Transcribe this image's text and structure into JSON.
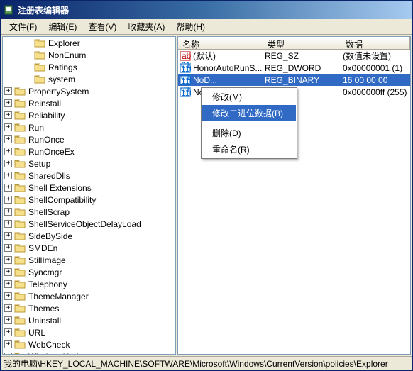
{
  "window": {
    "title": "注册表编辑器"
  },
  "menubar": {
    "file": "文件(F)",
    "edit": "编辑(E)",
    "view": "查看(V)",
    "favorites": "收藏夹(A)",
    "help": "帮助(H)"
  },
  "tree_expanded_children": [
    {
      "label": "Explorer"
    },
    {
      "label": "NonEnum"
    },
    {
      "label": "Ratings"
    },
    {
      "label": "system"
    }
  ],
  "tree_items": [
    {
      "label": "PropertySystem"
    },
    {
      "label": "Reinstall"
    },
    {
      "label": "Reliability"
    },
    {
      "label": "Run"
    },
    {
      "label": "RunOnce"
    },
    {
      "label": "RunOnceEx"
    },
    {
      "label": "Setup"
    },
    {
      "label": "SharedDlls"
    },
    {
      "label": "Shell Extensions"
    },
    {
      "label": "ShellCompatibility"
    },
    {
      "label": "ShellScrap"
    },
    {
      "label": "ShellServiceObjectDelayLoad"
    },
    {
      "label": "SideBySide"
    },
    {
      "label": "SMDEn"
    },
    {
      "label": "StillImage"
    },
    {
      "label": "Syncmgr"
    },
    {
      "label": "Telephony"
    },
    {
      "label": "ThemeManager"
    },
    {
      "label": "Themes"
    },
    {
      "label": "Uninstall"
    },
    {
      "label": "URL"
    },
    {
      "label": "WebCheck"
    },
    {
      "label": "WindowsUpdate"
    }
  ],
  "list": {
    "col_name": "名称",
    "col_type": "类型",
    "col_data": "数据",
    "rows": [
      {
        "icon": "string",
        "name": "(默认)",
        "type": "REG_SZ",
        "data": "(数值未设置)"
      },
      {
        "icon": "binary",
        "name": "HonorAutoRunS...",
        "type": "REG_DWORD",
        "data": "0x00000001 (1)"
      },
      {
        "icon": "binary",
        "name": "NoD...",
        "type": "REG_BINARY",
        "data": "16 00 00 00",
        "selected": true
      },
      {
        "icon": "binary",
        "name": "NoD...",
        "type": "",
        "data": "0x000000ff (255)"
      }
    ]
  },
  "context_menu": {
    "modify": "修改(M)",
    "modify_binary": "修改二进位数据(B)",
    "delete": "删除(D)",
    "rename": "重命名(R)"
  },
  "statusbar": {
    "path": "我的电脑\\HKEY_LOCAL_MACHINE\\SOFTWARE\\Microsoft\\Windows\\CurrentVersion\\policies\\Explorer"
  }
}
